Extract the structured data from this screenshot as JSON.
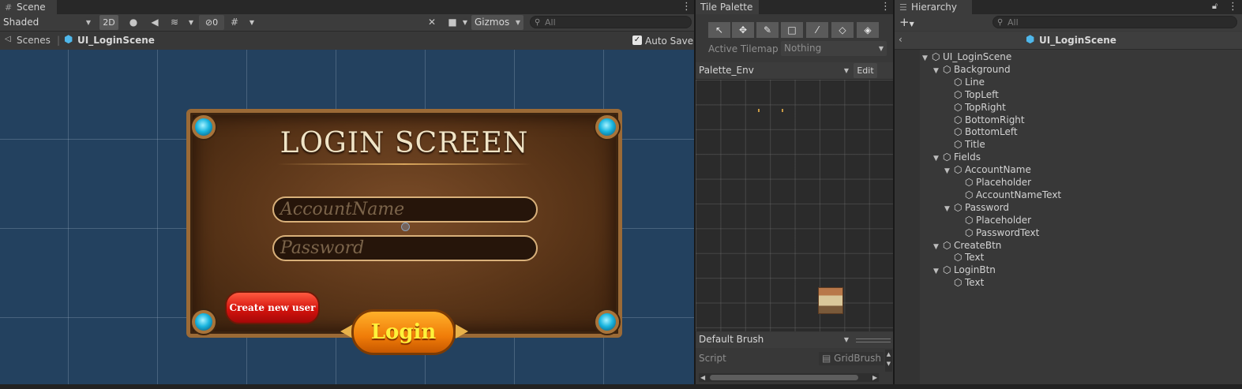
{
  "scene_panel": {
    "tab_title": "Scene",
    "shading_mode": "Shaded",
    "mode_2d": "2D",
    "hidden_count": "0",
    "gizmos_label": "Gizmos",
    "search_placeholder": "All",
    "breadcrumb_root": "Scenes",
    "breadcrumb_scene": "UI_LoginScene",
    "auto_save_label": "Auto Save",
    "auto_save_checked": true,
    "canvas": {
      "title": "LOGIN SCREEN",
      "account_placeholder": "AccountName",
      "password_placeholder": "Password",
      "create_button": "Create new user",
      "login_button": "Login"
    }
  },
  "tile_palette": {
    "tab_title": "Tile Palette",
    "active_tilemap_label": "Active Tilemap",
    "active_tilemap_value": "Nothing",
    "palette_name": "Palette_Env",
    "edit_button": "Edit",
    "brush_name": "Default Brush",
    "script_label": "Script",
    "script_value": "GridBrush",
    "tools": [
      "select-tool-icon",
      "move-tool-icon",
      "paint-brush-icon",
      "box-fill-icon",
      "picker-icon",
      "eraser-icon",
      "fill-bucket-icon"
    ]
  },
  "hierarchy": {
    "tab_title": "Hierarchy",
    "search_placeholder": "All",
    "scene_header": "UI_LoginScene",
    "items": [
      {
        "label": "UI_LoginScene",
        "depth": 0,
        "expanded": true
      },
      {
        "label": "Background",
        "depth": 1,
        "expanded": true
      },
      {
        "label": "Line",
        "depth": 2
      },
      {
        "label": "TopLeft",
        "depth": 2
      },
      {
        "label": "TopRight",
        "depth": 2
      },
      {
        "label": "BottomRight",
        "depth": 2
      },
      {
        "label": "BottomLeft",
        "depth": 2
      },
      {
        "label": "Title",
        "depth": 2
      },
      {
        "label": "Fields",
        "depth": 1,
        "expanded": true
      },
      {
        "label": "AccountName",
        "depth": 2,
        "expanded": true
      },
      {
        "label": "Placeholder",
        "depth": 3
      },
      {
        "label": "AccountNameText",
        "depth": 3
      },
      {
        "label": "Password",
        "depth": 2,
        "expanded": true
      },
      {
        "label": "Placeholder",
        "depth": 3
      },
      {
        "label": "PasswordText",
        "depth": 3
      },
      {
        "label": "CreateBtn",
        "depth": 1,
        "expanded": true
      },
      {
        "label": "Text",
        "depth": 2
      },
      {
        "label": "LoginBtn",
        "depth": 1,
        "expanded": true
      },
      {
        "label": "Text",
        "depth": 2
      }
    ]
  },
  "colors": {
    "scene_background": "#23415f",
    "panel_bg": "#383838",
    "tab_bg": "#282828"
  }
}
